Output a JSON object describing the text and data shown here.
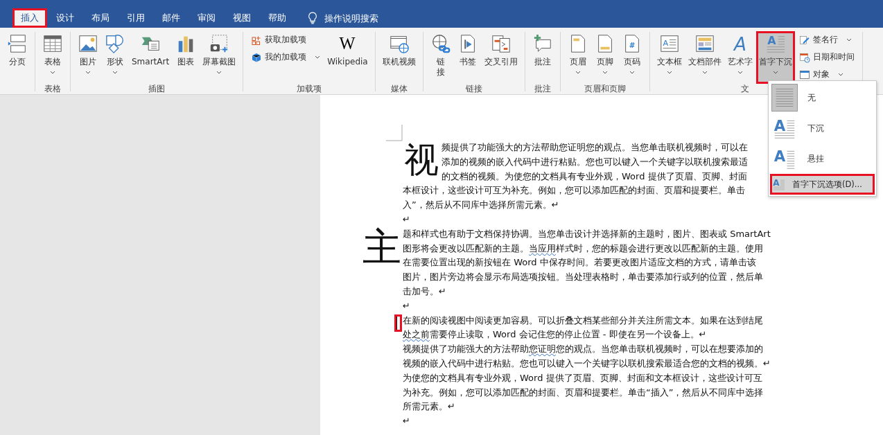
{
  "tabs": [
    {
      "label": "插入",
      "selected": true,
      "highlighted": true
    },
    {
      "label": "设计",
      "selected": false,
      "highlighted": false
    },
    {
      "label": "布局",
      "selected": false,
      "highlighted": false
    },
    {
      "label": "引用",
      "selected": false,
      "highlighted": false
    },
    {
      "label": "邮件",
      "selected": false,
      "highlighted": false
    },
    {
      "label": "审阅",
      "selected": false,
      "highlighted": false
    },
    {
      "label": "视图",
      "selected": false,
      "highlighted": false
    },
    {
      "label": "帮助",
      "selected": false,
      "highlighted": false
    }
  ],
  "tell_me": {
    "placeholder": "操作说明搜索"
  },
  "ribbon": {
    "groups": [
      {
        "items": [
          {
            "kind": "large",
            "label": "分页",
            "dropdown": false
          }
        ]
      },
      {
        "label": "表格",
        "items": [
          {
            "kind": "large",
            "label": "表格",
            "dropdown": true
          }
        ]
      },
      {
        "label": "插图",
        "items": [
          {
            "kind": "large",
            "label": "图片",
            "dropdown": true
          },
          {
            "kind": "large",
            "label": "形状",
            "dropdown": true
          },
          {
            "kind": "large",
            "label": "SmartArt",
            "dropdown": false
          },
          {
            "kind": "large",
            "label": "图表",
            "dropdown": false
          },
          {
            "kind": "large",
            "label": "屏幕截图",
            "dropdown": true
          }
        ]
      },
      {
        "label": "加载项",
        "items": [
          {
            "kind": "stack",
            "items": [
              {
                "label": "获取加载项",
                "dropdown": false
              },
              {
                "label": "我的加载项",
                "dropdown": true
              }
            ]
          },
          {
            "kind": "large",
            "label": "Wikipedia",
            "dropdown": false,
            "glyph": "W"
          }
        ]
      },
      {
        "label": "媒体",
        "items": [
          {
            "kind": "large",
            "label": "联机视频",
            "dropdown": false
          }
        ]
      },
      {
        "label": "链接",
        "items": [
          {
            "kind": "large",
            "label": "链接",
            "dropdown": false,
            "stacked_label": true
          },
          {
            "kind": "large",
            "label": "书签",
            "dropdown": false
          },
          {
            "kind": "large",
            "label": "交叉引用",
            "dropdown": false
          }
        ]
      },
      {
        "label": "批注",
        "items": [
          {
            "kind": "large",
            "label": "批注",
            "dropdown": false
          }
        ]
      },
      {
        "label": "页眉和页脚",
        "items": [
          {
            "kind": "large",
            "label": "页眉",
            "dropdown": true
          },
          {
            "kind": "large",
            "label": "页脚",
            "dropdown": true
          },
          {
            "kind": "large",
            "label": "页码",
            "dropdown": true,
            "glyph": "#"
          }
        ]
      },
      {
        "label": "文",
        "items": [
          {
            "kind": "large",
            "label": "文本框",
            "dropdown": true,
            "glyph": "A"
          },
          {
            "kind": "large",
            "label": "文档部件",
            "dropdown": true
          },
          {
            "kind": "large",
            "label": "艺术字",
            "dropdown": true,
            "glyph": "A"
          },
          {
            "kind": "large",
            "label": "首字下沉",
            "dropdown": true,
            "glyph": "A",
            "pressed": true,
            "highlighted": true
          },
          {
            "kind": "stack",
            "items": [
              {
                "label": "签名行",
                "dropdown": true
              },
              {
                "label": "日期和时间",
                "dropdown": false
              },
              {
                "label": "对象",
                "dropdown": true
              }
            ]
          }
        ]
      }
    ]
  },
  "drop_cap_menu": {
    "items": [
      {
        "kind": "none",
        "label": "无",
        "selected": true
      },
      {
        "kind": "dropped",
        "label": "下沉",
        "glyph": "A",
        "selected": false
      },
      {
        "kind": "in_margin",
        "label": "悬挂",
        "glyph": "A",
        "selected": false
      }
    ],
    "option": {
      "label": "首字下沉选项(D)...",
      "glyph": "A",
      "highlighted": true
    }
  },
  "document": {
    "paragraphs": [
      {
        "drop_cap": "视",
        "kind": "dropped_cap",
        "lines": [
          {
            "text": "频提供了功能强大的方法帮助您证明您的观点。当您单击联机视频时，可以在"
          },
          {
            "text": "添加的视频的嵌入代码中进行粘贴。您也可以键入一个关键字以联机搜索最适"
          },
          {
            "text": "的文档的视频。为使您的文档具有专业外观，Word 提供了页眉、页脚、封面"
          },
          {
            "text": "本框设计，这些设计可互为补充。例如，您可以添加匹配的封面、页眉和提要栏。单击"
          },
          {
            "text": "入”，然后从不同库中选择所需元素。↵"
          }
        ]
      },
      {
        "lines": [
          {
            "text": "↵"
          }
        ]
      },
      {
        "drop_cap": "主",
        "kind": "margin_cap",
        "lines": [
          {
            "text": "题和样式也有助于文档保持协调。当您单击设计并选择新的主题时，图片、图表或 SmartArt"
          },
          {
            "parts": [
              {
                "text": "图形将会更改以匹配新的主题。",
                "flagged": false
              },
              {
                "text": "当应用",
                "flagged": true
              },
              {
                "text": "样式时，您的标题会进行更改以匹配新的主题。使用",
                "flagged": false
              }
            ]
          },
          {
            "text": "在需要位置出现的新按钮在 Word 中保存时间。若要更改图片适应文档的方式，请单击该"
          },
          {
            "text": "图片，图片旁边将会显示布局选项按钮。当处理表格时，单击要添加行或列的位置，然后单"
          },
          {
            "text": "击加号。↵"
          }
        ]
      },
      {
        "lines": [
          {
            "text": "↵"
          }
        ]
      },
      {
        "caret": {
          "highlighted": true
        },
        "lines": [
          {
            "text": "在新的阅读视图中阅读更加容易。可以折叠文档某些部分并关注所需文本。如果在达到结尾"
          },
          {
            "parts": [
              {
                "text": "处之前",
                "flagged": true
              },
              {
                "text": "需要停止读取，Word 会记住您的停止位置 - 即使在另一个设备上。↵",
                "flagged": false
              }
            ]
          },
          {
            "parts": [
              {
                "text": "视频提供了功能强大的方法帮助",
                "flagged": false
              },
              {
                "text": "您证明",
                "flagged": true
              },
              {
                "text": "您的观点。当您单击联机视频时，可以在想要添加的",
                "flagged": false
              }
            ]
          },
          {
            "text": "视频的嵌入代码中进行粘贴。您也可以键入一个关键字以联机搜索最适合您的文档的视频。↵"
          },
          {
            "text": "为使您的文档具有专业外观，Word 提供了页眉、页脚、封面和文本框设计，这些设计可互"
          },
          {
            "text": "为补充。例如，您可以添加匹配的封面、页眉和提要栏。单击“插入”，然后从不同库中选择"
          },
          {
            "text": "所需元素。↵"
          }
        ]
      },
      {
        "lines": [
          {
            "text": "↵"
          }
        ]
      }
    ]
  }
}
